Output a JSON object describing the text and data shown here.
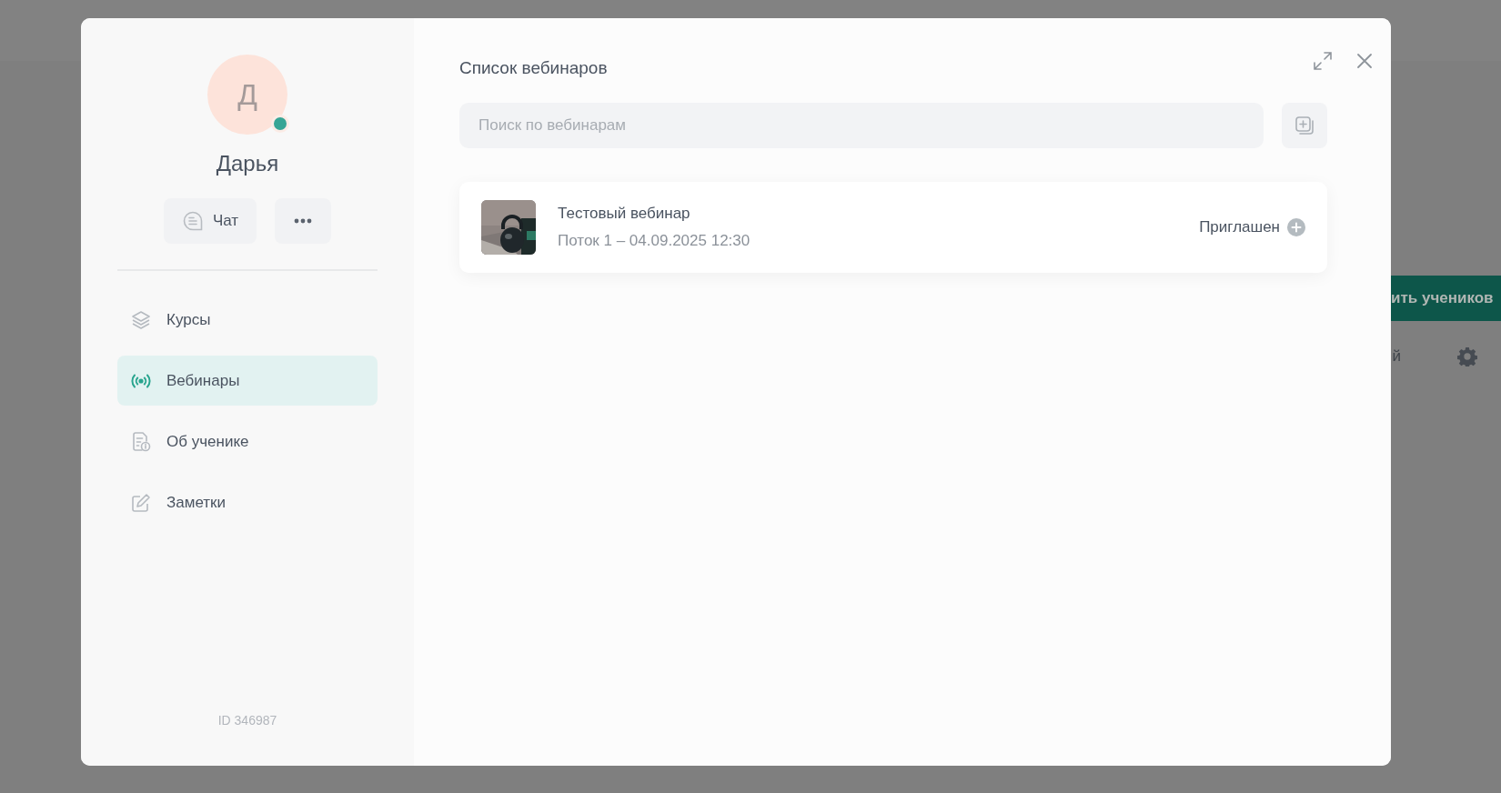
{
  "backdrop": {
    "add_button": "ить учеников",
    "column_header": "й"
  },
  "profile": {
    "initial": "Д",
    "online": true,
    "name": "Дарья",
    "chat_button": "Чат"
  },
  "nav": [
    {
      "label": "Курсы",
      "kind": "courses",
      "selected": false
    },
    {
      "label": "Вебинары",
      "kind": "webinars",
      "selected": true
    },
    {
      "label": "Об ученике",
      "kind": "about",
      "selected": false
    },
    {
      "label": "Заметки",
      "kind": "notes",
      "selected": false
    }
  ],
  "student_id": "ID 346987",
  "main": {
    "title": "Список вебинаров",
    "search": {
      "placeholder": "Поиск по вебинарам"
    },
    "webinars": [
      {
        "title": "Тестовый вебинар",
        "subtitle": "Поток 1 – 04.09.2025 12:30",
        "status": "Приглашен"
      }
    ]
  }
}
